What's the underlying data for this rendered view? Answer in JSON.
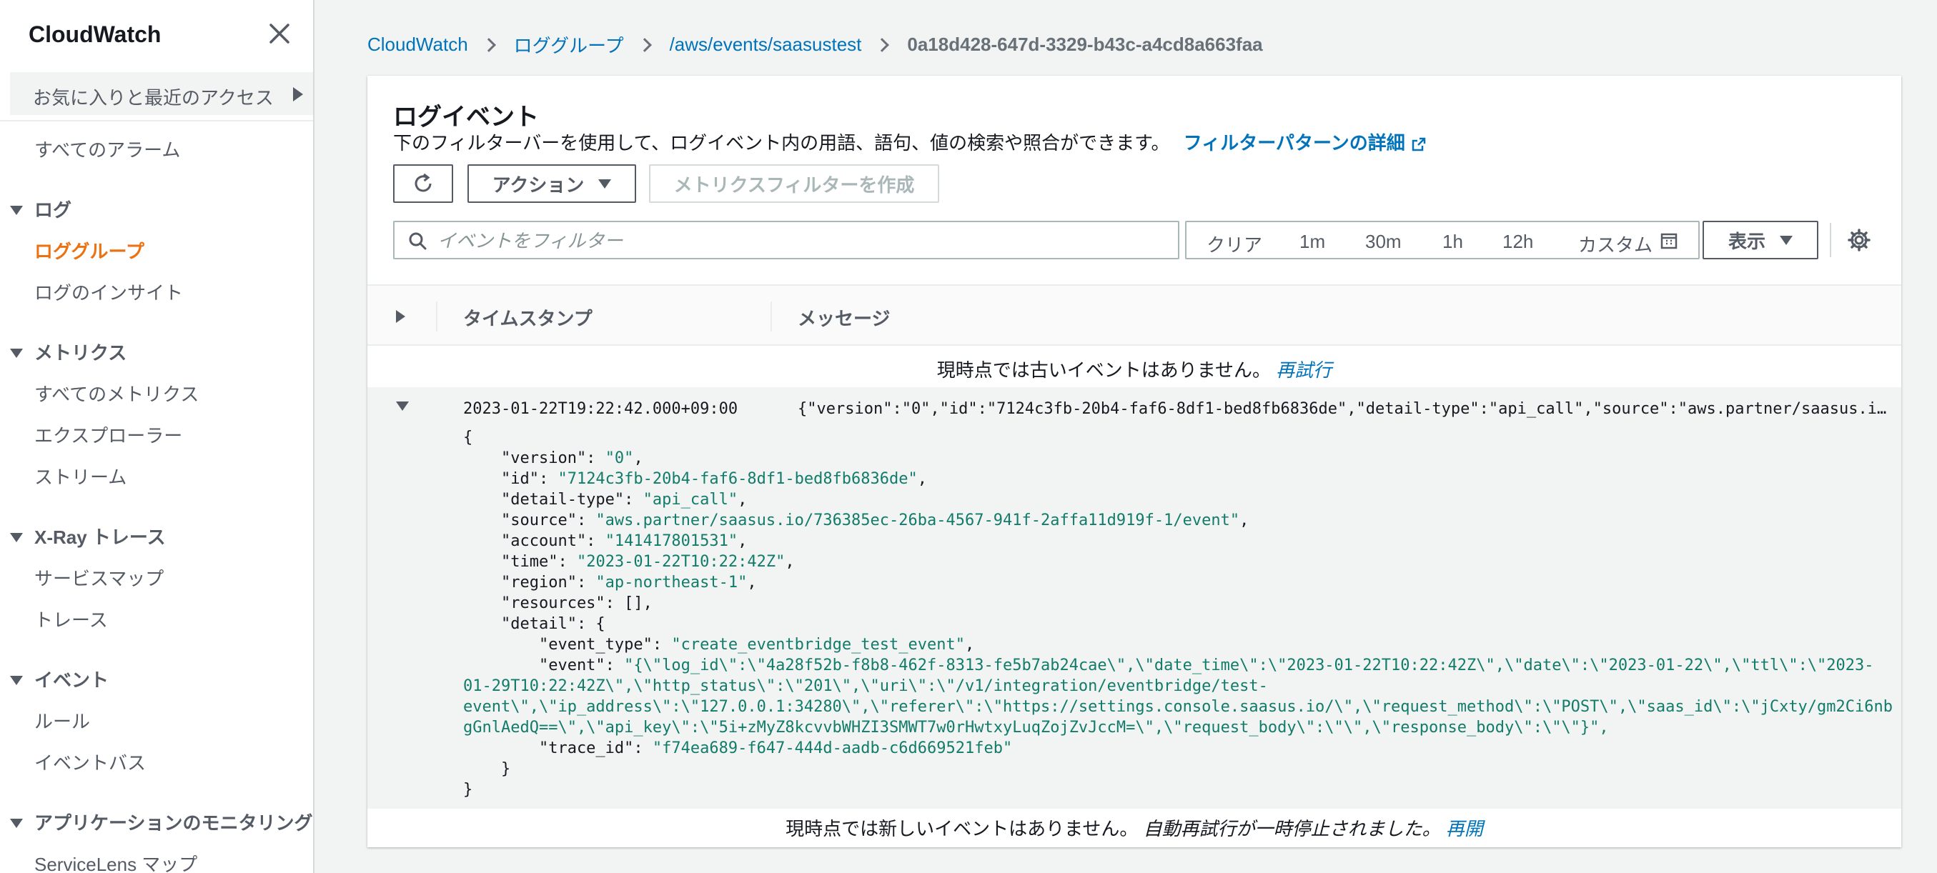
{
  "sidebar": {
    "title": "CloudWatch",
    "favorites": "お気に入りと最近のアクセス",
    "all_alarms": "すべてのアラーム",
    "sections": [
      {
        "label": "ログ",
        "items": [
          "ロググループ",
          "ログのインサイト"
        ]
      },
      {
        "label": "メトリクス",
        "items": [
          "すべてのメトリクス",
          "エクスプローラー",
          "ストリーム"
        ]
      },
      {
        "label": "X-Ray トレース",
        "items": [
          "サービスマップ",
          "トレース"
        ]
      },
      {
        "label": "イベント",
        "items": [
          "ルール",
          "イベントバス"
        ]
      },
      {
        "label": "アプリケーションのモニタリング",
        "items": [
          "ServiceLens マップ"
        ]
      }
    ]
  },
  "breadcrumb": {
    "items": [
      "CloudWatch",
      "ロググループ",
      "/aws/events/saasustest"
    ],
    "current": "0a18d428-647d-3329-b43c-a4cd8a663faa"
  },
  "panel": {
    "title": "ログイベント",
    "description": "下のフィルターバーを使用して、ログイベント内の用語、語句、値の検索や照合ができます。",
    "help_link": "フィルターパターンの詳細",
    "actions_label": "アクション",
    "create_metric_filter": "メトリクスフィルターを作成",
    "search_placeholder": "イベントをフィルター",
    "time_ranges": [
      "クリア",
      "1m",
      "30m",
      "1h",
      "12h",
      "カスタム"
    ],
    "display_label": "表示"
  },
  "table": {
    "col_timestamp": "タイムスタンプ",
    "col_message": "メッセージ",
    "no_older": "現時点では古いイベントはありません。",
    "retry": "再試行",
    "no_newer": "現時点では新しいイベントはありません。",
    "paused": "自動再試行が一時停止されました。",
    "resume": "再開"
  },
  "event": {
    "timestamp": "2023-01-22T19:22:42.000+09:00",
    "message": "{\"version\":\"0\",\"id\":\"7124c3fb-20b4-faf6-8df1-bed8fb6836de\",\"detail-type\":\"api_call\",\"source\":\"aws.partner/saasus.io…",
    "json_lines": [
      "{",
      "    \"version\": \"0\",",
      "    \"id\": \"7124c3fb-20b4-faf6-8df1-bed8fb6836de\",",
      "    \"detail-type\": \"api_call\",",
      "    \"source\": \"aws.partner/saasus.io/736385ec-26ba-4567-941f-2affa11d919f-1/event\",",
      "    \"account\": \"141417801531\",",
      "    \"time\": \"2023-01-22T10:22:42Z\",",
      "    \"region\": \"ap-northeast-1\",",
      "    \"resources\": [],",
      "    \"detail\": {",
      "        \"event_type\": \"create_eventbridge_test_event\",",
      "        \"event\": \"{\\\"log_id\\\":\\\"4a28f52b-f8b8-462f-8313-fe5b7ab24cae\\\",\\\"date_time\\\":\\\"2023-01-22T10:22:42Z\\\",\\\"date\\\":\\\"2023-01-22\\\",\\\"ttl\\\":\\\"2023-",
      "01-29T10:22:42Z\\\",\\\"http_status\\\":\\\"201\\\",\\\"uri\\\":\\\"/v1/integration/eventbridge/test-",
      "event\\\",\\\"ip_address\\\":\\\"127.0.0.1:34280\\\",\\\"referer\\\":\\\"https://settings.console.saasus.io/\\\",\\\"request_method\\\":\\\"POST\\\",\\\"saas_id\\\":\\\"jCxty/gm2Ci6nb",
      "gGnlAedQ==\\\",\\\"api_key\\\":\\\"5i+zMyZ8kcvvbWHZI3SMWT7w0rHwtxyLuqZojZvJccM=\\\",\\\"request_body\\\":\\\"\\\",\\\"response_body\\\":\\\"\\\"}\",",
      "        \"trace_id\": \"f74ea689-f647-444d-aadb-c6d669521feb\"",
      "    }",
      "}"
    ]
  },
  "colors": {
    "accent": "#ec7211",
    "link": "#0073bb",
    "json_string": "#127c6a"
  },
  "icons": [
    "close-icon",
    "chevron-right-icon",
    "chevron-down-icon",
    "external-link-icon",
    "refresh-icon",
    "search-icon",
    "calendar-icon",
    "gear-icon"
  ]
}
